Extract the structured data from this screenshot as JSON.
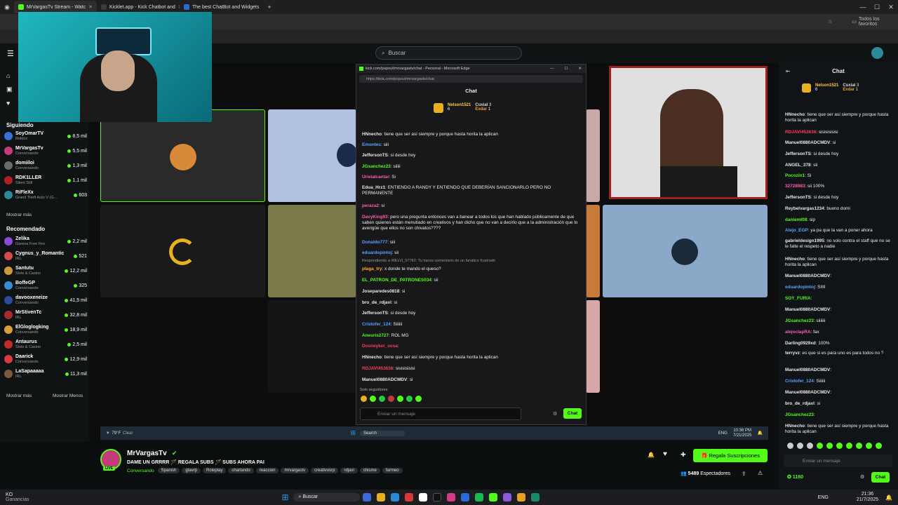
{
  "browser": {
    "tabs": [
      {
        "label": "MrVargasTv Stream - Watc"
      },
      {
        "label": "Kicklet.app - Kick Chatbot and"
      },
      {
        "label": "The best ChatBot and Widgets"
      }
    ],
    "favorites_label": "Todos los favoritos"
  },
  "header": {
    "search_placeholder": "Buscar"
  },
  "sidebar": {
    "following_title": "Siguiendo",
    "following": [
      {
        "name": "SoyOmarTV",
        "category": "Roblox",
        "viewers": "8,5 mil",
        "color": "#3a6fd8"
      },
      {
        "name": "MrVargasTv",
        "category": "Conversando",
        "viewers": "5,5 mil",
        "color": "#c43a7a"
      },
      {
        "name": "domiiloi",
        "category": "Conversando",
        "viewers": "1,3 mil",
        "color": "#6a6a6a"
      },
      {
        "name": "RDK1LLER",
        "category": "Silent Still",
        "viewers": "1,1 mil",
        "color": "#b02020"
      },
      {
        "name": "RiFleXx",
        "category": "Grand Theft Auto V (G...",
        "viewers": "603",
        "color": "#2a8a9a"
      }
    ],
    "show_more": "Mostrar más",
    "recommended_title": "Recomendado",
    "recommended": [
      {
        "name": "Zelika",
        "category": "Garena Free Fire",
        "viewers": "2,2 mil",
        "color": "#8a4ad8"
      },
      {
        "name": "Cygnus_y_Romantic",
        "category": "IRL",
        "viewers": "521",
        "color": "#d84a4a"
      },
      {
        "name": "Santutu",
        "category": "Slots & Casino",
        "viewers": "12,2 mil",
        "color": "#c89a3a"
      },
      {
        "name": "BoffeGP",
        "category": "Conversando",
        "viewers": "325",
        "color": "#3a8ad8"
      },
      {
        "name": "davooxeneize",
        "category": "Conversando",
        "viewers": "41,5 mil",
        "color": "#2a4a9a"
      },
      {
        "name": "MrStivenTc",
        "category": "IRL",
        "viewers": "32,8 mil",
        "color": "#aa2a2a"
      },
      {
        "name": "ElGloglogking",
        "category": "Conversando",
        "viewers": "18,9 mil",
        "color": "#d8a03a"
      },
      {
        "name": "Antaurus",
        "category": "Slots & Casino",
        "viewers": "2,5 mil",
        "color": "#c02a2a"
      },
      {
        "name": "Daarick",
        "category": "Conversando",
        "viewers": "12,9 mil",
        "color": "#da3a3a"
      },
      {
        "name": "LaSapaaaaa",
        "category": "IRL",
        "viewers": "11,3 mil",
        "color": "#7a5a3a"
      }
    ],
    "show_more_2": "Mostrar más",
    "show_less": "Mostrar Menos"
  },
  "popout": {
    "window_title": "kick.com/popout/mrvargastv/chat - Personal - Microsoft Edge",
    "url": "https://kick.com/popout/mrvargastv/chat",
    "title": "Chat",
    "top_gifters": [
      {
        "name": "Nelson1521",
        "count": "6"
      },
      {
        "name": "Cuxial",
        "count": "3"
      },
      {
        "name": "Exdar",
        "count": "1"
      }
    ],
    "messages": [
      {
        "user": "HNnecho",
        "color": "#e8e8e8",
        "text": "tiene que ser así siempre y porque hasta horita la aplican"
      },
      {
        "user": "Emontes",
        "color": "#5aa0ff",
        "text": "siii"
      },
      {
        "user": "JeffersonTS",
        "color": "#e8e8e8",
        "text": "si desde hoy"
      },
      {
        "user": "JGsanchez23",
        "color": "#53fc18",
        "text": "siiiii"
      },
      {
        "user": "Urielalcantar",
        "color": "#ff5ab0",
        "text": "Si"
      },
      {
        "user": "Edua_Hrz1",
        "color": "#e8e8e8",
        "text": "ENTIENDO A RANDY Y ENTIENDO QUE DEBERÍAN SANCIONARLO PERO NO PERMANENTE"
      },
      {
        "user": "peraza2",
        "color": "#ff5ab0",
        "text": "si"
      },
      {
        "user": "DavyKing93",
        "color": "#ff5ab0",
        "text": "pero una pregunta entonces van a banear a todos los que han hablado públicamente de que saben quienes están menutiado en creativos y han dicho que no van a decirlo que a la administración que lo averigüe que ellos no son chivatos????"
      },
      {
        "user": "Donaldo777",
        "color": "#5aa0ff",
        "text": "siii"
      },
      {
        "user": "eduardopintoj",
        "color": "#5aa0ff",
        "text": "sii"
      },
      {
        "user": "plaga_try",
        "color": "#ffaa3a",
        "text": "x donde te mando el queso?"
      },
      {
        "user": "EL_PATRON_DE_PATRONES034",
        "color": "#53fc18",
        "text": "sii"
      },
      {
        "user": "Joseparedes0818",
        "color": "#e8e8e8",
        "text": "si"
      },
      {
        "user": "bro_de_rdjavi",
        "color": "#e8e8e8",
        "text": "si"
      },
      {
        "user": "JeffersonTS",
        "color": "#e8e8e8",
        "text": "si desde hoy"
      },
      {
        "user": "Cristofer_124",
        "color": "#5aa0ff",
        "text": "Siiiiii"
      },
      {
        "user": "Aneuris2727",
        "color": "#53fc18",
        "text": "ROL MG"
      },
      {
        "user": "Dosneyker_sosa",
        "color": "#ff3a5a",
        "text": ""
      },
      {
        "user": "HNnecho",
        "color": "#e8e8e8",
        "text": "tiene que ser así siempre y porque hasta horita la aplican"
      },
      {
        "user": "RDJAVI453636",
        "color": "#ff3a5a",
        "text": "sisisisisisi"
      },
      {
        "user": "Manuel0880ADCMDV",
        "color": "#e8e8e8",
        "text": "si"
      }
    ],
    "reply_label": "Respondiendo a WELVI_07782: Tu haces comentario de un fanático frustrado",
    "followers_only": "Solo seguidores",
    "input_placeholder": "Enviar un mensaje",
    "send_label": "Chat"
  },
  "inner_taskbar": {
    "weather": "79°F",
    "weather_desc": "Clear",
    "search": "Search",
    "lang": "ENG",
    "time": "10:36 PM",
    "date": "7/21/2025"
  },
  "stream_info": {
    "streamer": "MrVargasTv",
    "title": "DAME UN GRRRR 🪄 REGALA SUBS 🪄 SUBS AHORA PAI",
    "category": "Conversando",
    "tags": [
      "Spanish",
      "gtavrp",
      "Roleplay",
      "charlando",
      "reaccion",
      "mrvargastv",
      "creativosrp",
      "rdjavi",
      "chisme",
      "farmeo"
    ],
    "subscribe_label": "Regala Suscripciones",
    "viewers": "5489",
    "viewers_label": "Espectadores",
    "live_badge": "LIVE"
  },
  "right_chat": {
    "title": "Chat",
    "top_gifters": [
      {
        "name": "Nelson1521",
        "count": "6"
      },
      {
        "name": "Cuxial",
        "count": "3"
      },
      {
        "name": "Exdar",
        "count": "1"
      }
    ],
    "messages": [
      {
        "user": "HNnecho",
        "color": "#e8e8e8",
        "text": "tiene que ser así siempre y porque hasta horita la aplican"
      },
      {
        "user": "RDJAVI453636",
        "color": "#ff3a5a",
        "text": "sisisisisisi"
      },
      {
        "user": "Manuel0880ADCMDV",
        "color": "#e8e8e8",
        "text": "si"
      },
      {
        "user": "JeffersonTS",
        "color": "#e8e8e8",
        "text": "si desde hoy"
      },
      {
        "user": "ANGEL_378",
        "color": "#e8e8e8",
        "text": "sii"
      },
      {
        "user": "Pocozin1",
        "color": "#53fc18",
        "text": "Si"
      },
      {
        "user": "32728983",
        "color": "#ff5ab0",
        "text": "sii 100%"
      },
      {
        "user": "JeffersonTS",
        "color": "#e8e8e8",
        "text": "si desde hoy"
      },
      {
        "user": "Reybelvargas1234",
        "color": "#e8e8e8",
        "text": "bueno domi"
      },
      {
        "user": "danieml08",
        "color": "#53fc18",
        "text": "sip"
      },
      {
        "user": "Alejo_EGP",
        "color": "#5aa0ff",
        "text": "ya pa que la van a poner ahora"
      },
      {
        "user": "gabrieldesign1995",
        "color": "#e8e8e8",
        "text": "no solo contra el staff que no se le falte el respeto a nadie"
      },
      {
        "user": "HNnecho",
        "color": "#e8e8e8",
        "text": "tiene que ser así siempre y porque hasta horita la aplican"
      },
      {
        "user": "Manuel0880ADCMDV",
        "color": "#e8e8e8",
        "text": ""
      },
      {
        "user": "eduardopintoj",
        "color": "#5aa0ff",
        "text": "SIIII"
      },
      {
        "user": "SOY_FURIA",
        "color": "#53fc18",
        "text": ""
      },
      {
        "user": "Manuel0880ADCMDV",
        "color": "#e8e8e8",
        "text": ""
      },
      {
        "user": "JGsanchez23",
        "color": "#53fc18",
        "text": "siiiiiii"
      },
      {
        "user": "alejoclapRA",
        "color": "#ff5ab0",
        "text": "fax"
      },
      {
        "user": "Darling0929xd",
        "color": "#e8e8e8",
        "text": "100%"
      },
      {
        "user": "terryvz",
        "color": "#e8e8e8",
        "text": "es que si es para uno es para todos no ?"
      },
      {
        "user": "Manuel0880ADCMDV",
        "color": "#e8e8e8",
        "text": ""
      },
      {
        "user": "Cristofer_124",
        "color": "#5aa0ff",
        "text": "Siiiiii"
      },
      {
        "user": "Manuel0880ADCMDV",
        "color": "#e8e8e8",
        "text": ""
      },
      {
        "user": "bro_de_rdjavi",
        "color": "#e8e8e8",
        "text": "si"
      },
      {
        "user": "JGsanchez23",
        "color": "#53fc18",
        "text": ""
      },
      {
        "user": "HNnecho",
        "color": "#e8e8e8",
        "text": "tiene que ser así siempre y porque hasta horita la aplican"
      }
    ],
    "input_placeholder": "Enviar un mensaje",
    "points": "1160",
    "send_label": "Chat"
  },
  "taskbar": {
    "search": "Buscar",
    "weather_temp": "KO",
    "weather_desc": "Ganancias",
    "lang": "ENG",
    "time": "21:36",
    "date": "21/7/2025"
  },
  "colors": {
    "brand": "#53fc18",
    "bg": "#0b0e0f"
  }
}
